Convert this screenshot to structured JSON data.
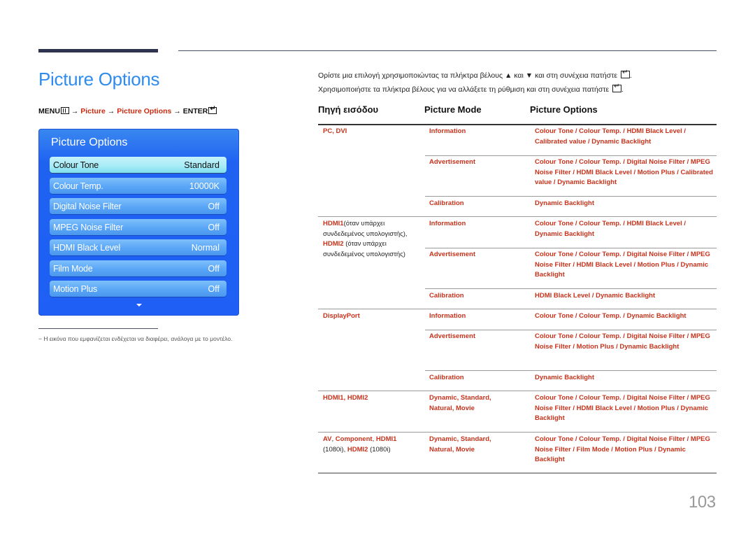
{
  "page": {
    "title": "Picture Options",
    "page_number": "103"
  },
  "breadcrumb": {
    "menu": "MENU",
    "arrow": "→",
    "picture": "Picture",
    "picture_options": "Picture Options",
    "enter": "ENTER"
  },
  "osd": {
    "title": "Picture Options",
    "items": [
      {
        "label": "Colour Tone",
        "value": "Standard",
        "selected": true
      },
      {
        "label": "Colour Temp.",
        "value": "10000K"
      },
      {
        "label": "Digital Noise Filter",
        "value": "Off"
      },
      {
        "label": "MPEG Noise Filter",
        "value": "Off"
      },
      {
        "label": "HDMI Black Level",
        "value": "Normal"
      },
      {
        "label": "Film Mode",
        "value": "Off"
      },
      {
        "label": "Motion Plus",
        "value": "Off"
      }
    ],
    "more_icon": "chevron-down-icon"
  },
  "footnote": "−  Η εικόνα που εμφανίζεται ενδέχεται να διαφέρει, ανάλογα με το μοντέλο.",
  "intro": {
    "line1_a": "Ορίστε μια επιλογή χρησιμοποιώντας τα πλήκτρα βέλους",
    "up": "▲",
    "and": "και",
    "down": "▼",
    "line1_b": "και στη συνέχεια πατήστε",
    "line2": "Χρησιμοποιήστε τα πλήκτρα βέλους για να αλλάξετε τη ρύθμιση και στη συνέχεια πατήστε",
    "period": "."
  },
  "table": {
    "headers": [
      "Πηγή εισόδου",
      "Picture Mode",
      "Picture Options"
    ],
    "rows": [
      {
        "source": "PC, DVI",
        "mode": "Information",
        "options": "Colour Tone / Colour Temp. / HDMI Black Level / Calibrated value / Dynamic Backlight"
      },
      {
        "source": "",
        "mode": "Advertisement",
        "options": "Colour Tone / Colour Temp. / Digital Noise Filter / MPEG Noise Filter / HDMI Black Level / Motion Plus / Calibrated value / Dynamic Backlight"
      },
      {
        "source": "",
        "mode": "Calibration",
        "options": "Dynamic Backlight"
      },
      {
        "source": "HDMI1(όταν υπάρχει συνδεδεμένος υπολογιστής), HDMI2 (όταν υπάρχει συνδεδεμένος υπολογιστής)",
        "mode": "Information",
        "options": "Colour Tone / Colour Temp. / HDMI Black Level / Dynamic Backlight"
      },
      {
        "source": "",
        "mode": "Advertisement",
        "options": "Colour Tone / Colour Temp. / Digital Noise Filter / MPEG Noise Filter / HDMI Black Level / Motion Plus / Dynamic Backlight"
      },
      {
        "source": "",
        "mode": "Calibration",
        "options": "HDMI Black Level / Dynamic Backlight"
      },
      {
        "source": "DisplayPort",
        "mode": "Information",
        "options": "Colour Tone / Colour Temp. / Dynamic Backlight"
      },
      {
        "source": "",
        "mode": "Advertisement",
        "options": "Colour Tone / Colour Temp. / Digital Noise Filter / MPEG Noise Filter / Motion Plus / Dynamic Backlight"
      },
      {
        "source": "",
        "mode": "Calibration",
        "options": "Dynamic Backlight"
      },
      {
        "source": "HDMI1, HDMI2",
        "mode": "Dynamic, Standard, Natural, Movie",
        "options": "Colour Tone / Colour Temp. / Digital Noise Filter / MPEG Noise Filter / HDMI Black Level / Motion Plus / Dynamic Backlight"
      },
      {
        "source": "AV, Component, HDMI1 (1080i), HDMI2 (1080i)",
        "mode": "Dynamic, Standard, Natural, Movie",
        "options": "Colour Tone / Colour Temp. / Digital Noise Filter / MPEG Noise Filter / Film Mode / Motion Plus / Dynamic Backlight"
      }
    ],
    "hdmi_pc": {
      "hdmi1": "HDMI1",
      "hdmi1_note": "(όταν υπάρχει συνδεδεμένος υπολογιστής),",
      "hdmi2": "HDMI2",
      "hdmi2_note": "(όταν υπάρχει συνδεδεμένος υπολογιστής)"
    },
    "av_row": {
      "av": "AV",
      "component": "Component",
      "hdmi1": "HDMI1",
      "res1": "(1080i),",
      "hdmi2": "HDMI2",
      "res2": "(1080i)"
    }
  },
  "colors": {
    "title_blue": "#2e8cf0",
    "accent_red": "#c8321b",
    "osd_blue": "#1f5ff5",
    "osd_selected": "#a9ecf6"
  }
}
